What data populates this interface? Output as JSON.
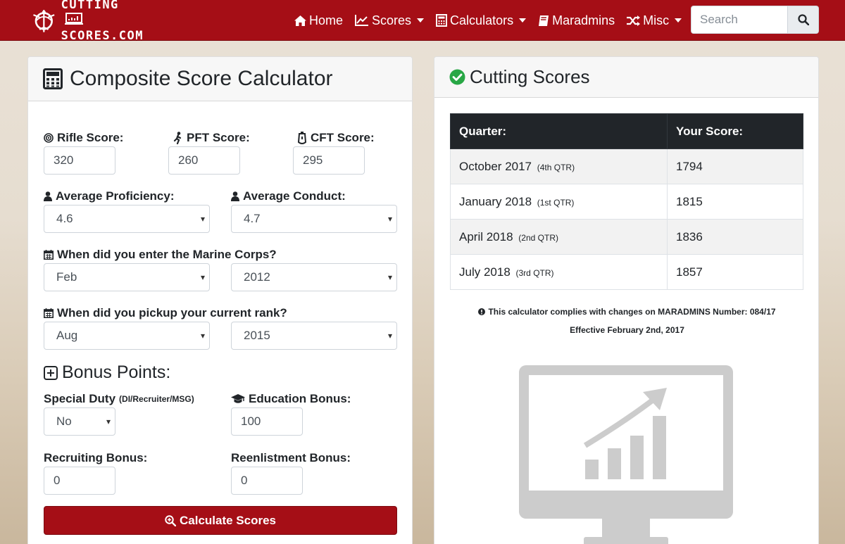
{
  "brand": {
    "line1": "CUTTING",
    "line2": "SCORES.COM"
  },
  "nav": {
    "home": "Home",
    "scores": "Scores",
    "calculators": "Calculators",
    "maradmins": "Maradmins",
    "misc": "Misc",
    "search_placeholder": "Search"
  },
  "calculator": {
    "title": "Composite Score Calculator",
    "rifle_label": "Rifle Score:",
    "rifle_value": "320",
    "pft_label": "PFT Score:",
    "pft_value": "260",
    "cft_label": "CFT Score:",
    "cft_value": "295",
    "pro_label": "Average Proficiency:",
    "pro_value": "4.6",
    "con_label": "Average Conduct:",
    "con_value": "4.7",
    "enter_label": "When did you enter the Marine Corps?",
    "enter_month": "Feb",
    "enter_year": "2012",
    "rank_label": "When did you pickup your current rank?",
    "rank_month": "Aug",
    "rank_year": "2015",
    "bonus_title": "Bonus Points:",
    "special_duty_label": "Special Duty",
    "special_duty_sub": "(DI/Recruiter/MSG)",
    "special_duty_value": "No",
    "education_label": "Education Bonus:",
    "education_value": "100",
    "recruiting_label": "Recruiting Bonus:",
    "recruiting_value": "0",
    "reenlistment_label": "Reenlistment Bonus:",
    "reenlistment_value": "0",
    "button": "Calculate Scores"
  },
  "cutting": {
    "title": "Cutting Scores",
    "col_quarter": "Quarter:",
    "col_score": "Your Score:",
    "rows": [
      {
        "quarter": "October 2017",
        "qtr": "(4th QTR)",
        "score": "1794"
      },
      {
        "quarter": "January 2018",
        "qtr": "(1st QTR)",
        "score": "1815"
      },
      {
        "quarter": "April 2018",
        "qtr": "(2nd QTR)",
        "score": "1836"
      },
      {
        "quarter": "July 2018",
        "qtr": "(3rd QTR)",
        "score": "1857"
      }
    ],
    "note1": "This calculator complies with changes on MARADMINS Number: 084/17",
    "note2": "Effective February 2nd, 2017"
  },
  "colors": {
    "brand_red": "#a50e16",
    "table_header": "#212529",
    "check_green": "#28a745"
  },
  "icons": [
    "home-icon",
    "chart-icon",
    "calculator-icon",
    "book-icon",
    "random-icon",
    "search-icon",
    "bullseye-icon",
    "running-icon",
    "stopwatch-icon",
    "user-icon",
    "calendar-icon",
    "plus-square-icon",
    "graduation-cap-icon",
    "search-plus-icon",
    "check-circle-icon",
    "info-icon",
    "monitor-chart-icon"
  ]
}
